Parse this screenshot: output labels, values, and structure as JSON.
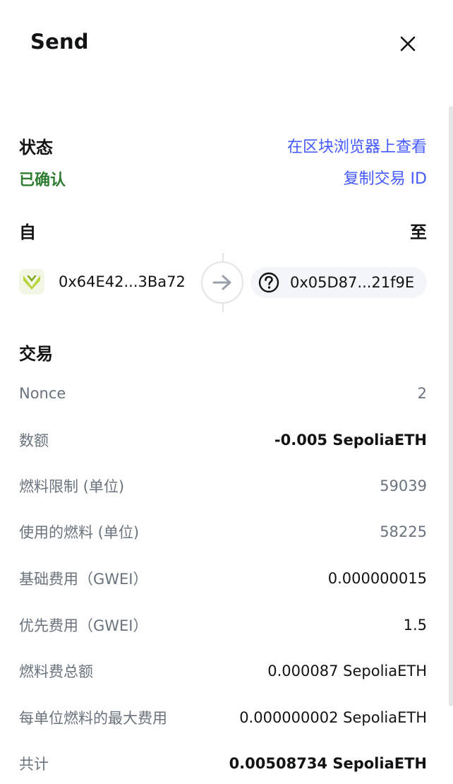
{
  "header": {
    "title": "Send"
  },
  "status": {
    "heading": "状态",
    "value": "已确认",
    "explorer_link": "在区块浏览器上查看",
    "copy_link": "复制交易 ID"
  },
  "parties": {
    "from_label": "自",
    "to_label": "至",
    "from_address": "0x64E42...3Ba72",
    "to_address": "0x05D87...21f9E"
  },
  "transaction": {
    "heading": "交易",
    "rows": [
      {
        "label": "Nonce",
        "value": "2"
      },
      {
        "label": "数额",
        "value": "-0.005 SepoliaETH"
      },
      {
        "label": "燃料限制 (单位)",
        "value": "59039"
      },
      {
        "label": "使用的燃料 (单位)",
        "value": "58225"
      },
      {
        "label": "基础费用（GWEI）",
        "value": "0.000000015"
      },
      {
        "label": "优先费用（GWEI）",
        "value": "1.5"
      },
      {
        "label": "燃料费总额",
        "value": "0.000087 SepoliaETH"
      },
      {
        "label": "每单位燃料的最大费用",
        "value": "0.000000002 SepoliaETH"
      },
      {
        "label": "共计",
        "value": "0.00508734 SepoliaETH"
      }
    ]
  },
  "colors": {
    "success": "#2f7d32",
    "link": "#4459ff",
    "muted": "#6a737d"
  }
}
